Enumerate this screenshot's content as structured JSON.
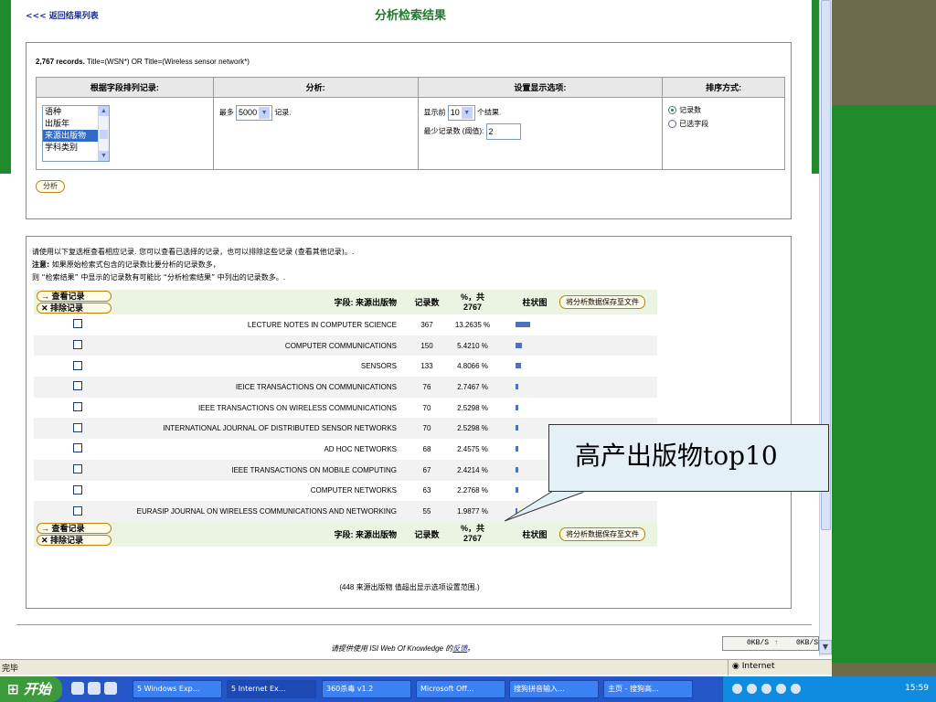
{
  "header": {
    "back_link": "<<< 返回结果列表",
    "title": "分析检索结果"
  },
  "query": {
    "count": "2,767 records.",
    "text": " Title=(WSN*) OR Title=(Wireless sensor network*)"
  },
  "options": {
    "col1_header": "根据字段排列记录:",
    "col2_header": "分析:",
    "col3_header": "设置显示选项:",
    "col4_header": "排序方式:",
    "fields": [
      "语种",
      "出版年",
      "来源出版物",
      "学科类别"
    ],
    "selected_field": "来源出版物",
    "max_prefix": "最多",
    "max_value": "5000",
    "max_suffix": "记录.",
    "show_prefix": "显示前",
    "show_value": "10",
    "show_suffix": "个结果.",
    "min_label": "最少记录数 (阈值):",
    "min_value": "2",
    "sort_count": "记录数",
    "sort_field": "已选字段",
    "analyze_button": "分析"
  },
  "note": {
    "line1": "请使用以下复选框查看相应记录. 您可以查看已选择的记录，也可以排除这些记录 (查看其他记录)。.",
    "line2_bold": "注意:",
    "line2": " 如果原始检索式包含的记录数比要分析的记录数多，",
    "line3": "则 “检索结果” 中显示的记录数有可能比 “分析检索结果” 中列出的记录数多。."
  },
  "results": {
    "view_button": "→ 查看记录",
    "exclude_button": "✕ 排除记录",
    "field_header": "字段: 来源出版物",
    "count_header": "记录数",
    "pct_header": "%，共",
    "pct_total": "2767",
    "bar_header": "柱状图",
    "save_button": "将分析数据保存至文件",
    "rows": [
      {
        "name": "LECTURE NOTES IN COMPUTER SCIENCE",
        "count": "367",
        "pct": "13.2635 %",
        "pct_value": 13.2635
      },
      {
        "name": "COMPUTER COMMUNICATIONS",
        "count": "150",
        "pct": "5.4210 %",
        "pct_value": 5.421
      },
      {
        "name": "SENSORS",
        "count": "133",
        "pct": "4.8066 %",
        "pct_value": 4.8066
      },
      {
        "name": "IEICE TRANSACTIONS ON COMMUNICATIONS",
        "count": "76",
        "pct": "2.7467 %",
        "pct_value": 2.7467
      },
      {
        "name": "IEEE TRANSACTIONS ON WIRELESS COMMUNICATIONS",
        "count": "70",
        "pct": "2.5298 %",
        "pct_value": 2.5298
      },
      {
        "name": "INTERNATIONAL JOURNAL OF DISTRIBUTED SENSOR NETWORKS",
        "count": "70",
        "pct": "2.5298 %",
        "pct_value": 2.5298
      },
      {
        "name": "AD HOC NETWORKS",
        "count": "68",
        "pct": "2.4575 %",
        "pct_value": 2.4575
      },
      {
        "name": "IEEE TRANSACTIONS ON MOBILE COMPUTING",
        "count": "67",
        "pct": "2.4214 %",
        "pct_value": 2.4214
      },
      {
        "name": "COMPUTER NETWORKS",
        "count": "63",
        "pct": "2.2768 %",
        "pct_value": 2.2768
      },
      {
        "name": "EURASIP JOURNAL ON WIRELESS COMMUNICATIONS AND NETWORKING",
        "count": "55",
        "pct": "1.9877 %",
        "pct_value": 1.9877
      }
    ],
    "footnote": "(448 来源出版物 值超出显示选项设置范围.)"
  },
  "footer": {
    "feedback_prefix": "请提供使用 ISI Web Of Knowledge 的",
    "feedback_link": "反馈",
    "feedback_suffix": "。"
  },
  "callout": {
    "text": "高产出版物top10"
  },
  "speed": {
    "down": "0KB/S",
    "up": "0KB/S"
  },
  "statusbar": {
    "status": "完毕",
    "zone": "Internet"
  },
  "taskbar": {
    "start": "开始",
    "tasks": [
      "5 Windows Exp...",
      "5 Internet Ex...",
      "360杀毒 v1.2",
      "Microsoft Off...",
      "搜狗拼音输入...",
      "主页 - 搜狗高..."
    ],
    "clock": "15:59"
  },
  "colors": {
    "accent_green": "#1f8a2a",
    "link_blue": "#1b2c9c",
    "bar_blue": "#4f6fbf",
    "callout_bg": "#e3f1f7"
  }
}
